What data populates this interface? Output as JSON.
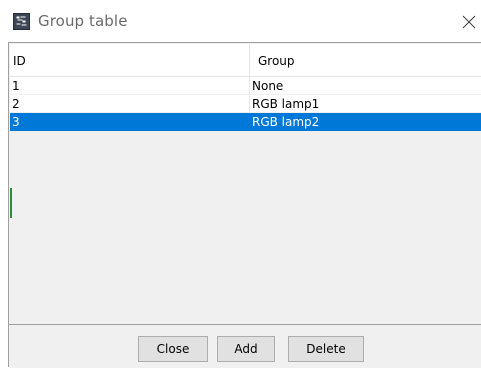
{
  "window": {
    "title": "Group table",
    "app_icon": "group-table-app-icon",
    "close_icon": "close-icon"
  },
  "table": {
    "columns": [
      "ID",
      "Group"
    ],
    "rows": [
      {
        "id": "1",
        "group": "None",
        "selected": false
      },
      {
        "id": "2",
        "group": "RGB lamp1",
        "selected": false
      },
      {
        "id": "3",
        "group": "RGB lamp2",
        "selected": true
      }
    ]
  },
  "buttons": {
    "close": "Close",
    "add": "Add",
    "delete": "Delete"
  },
  "colors": {
    "selection": "#0078d7",
    "selection_text": "#ffffff",
    "button_face": "#e1e1e1",
    "dialog_background": "#f0f0f0"
  }
}
